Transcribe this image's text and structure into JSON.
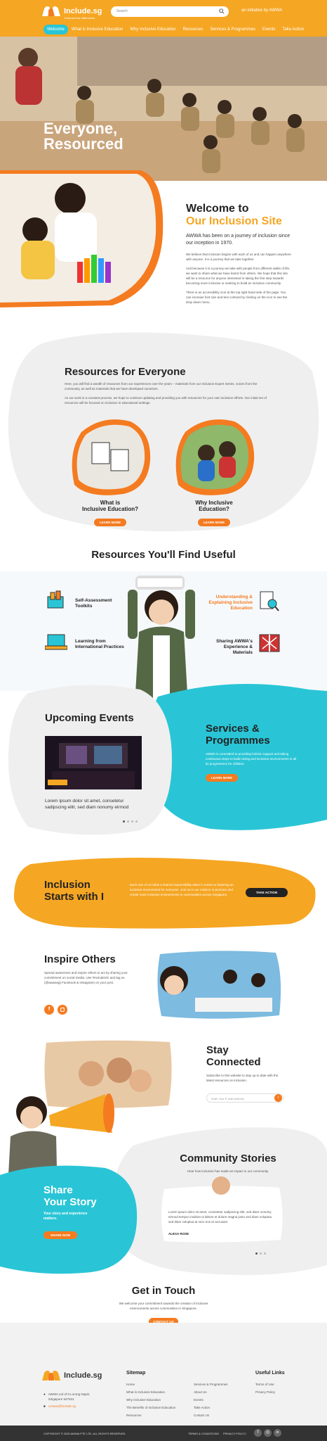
{
  "header": {
    "logo": "Include.sg",
    "logo_sub": "Embrace the differences",
    "search_placeholder": "Search",
    "tagline": "an initiative by AWWA"
  },
  "nav": [
    "Welcome",
    "What is Inclusive Education",
    "Why Inclusive Education",
    "Resources",
    "Services & Programmes",
    "Events",
    "Take Action"
  ],
  "hero": {
    "title_line1": "Everyone,",
    "title_line2": "Resourced"
  },
  "welcome": {
    "title1": "Welcome to",
    "title2": "Our Inclusion Site",
    "lead": "AWWA has been on a journey of inclusion since our inception in 1970.",
    "p1": "We believe that inclusion begins with each of us and can happen anywhere with anyone. It is a journey that we take together.",
    "p2": "And because it is a journey we take with people from different walks of life, we want to share what we have learnt from others. We hope that this site will be a resource for anyone interested in taking the first step towards becoming more inclusive or seeking to build an inclusive community.",
    "p3": "There is an accessibility icon at the top right-hand side of the page. You can increase font size and text contrast by clicking on the icon to see the drop down menu."
  },
  "resources": {
    "title": "Resources for Everyone",
    "p1": "Here, you will find a wealth of resources from our experiences over the years – materials from our Inclusion Expert Series, voices from the community, as well as materials that we have developed ourselves.",
    "p2": "As our work is a constant process, we hope to continue updating and providing you with resources for your own inclusion efforts. Our initial set of resources will be focused on inclusion in educational settings.",
    "card1_l1": "What is",
    "card1_l2": "Inclusive Education?",
    "card2_l1": "Why Inclusive",
    "card2_l2": "Education?",
    "learn_more": "LEARN MORE"
  },
  "useful": {
    "title": "Resources You'll Find Useful",
    "i1": "Self-Assessment Toolkits",
    "i2": "Understanding & Explaining Inclusive Education",
    "i3": "Learning from International Practices",
    "i4": "Sharing AWWA's Experience & Materials"
  },
  "events": {
    "title": "Upcoming Events",
    "text": "Lorem ipsum dolor sit amet, consetetur sadipscing elitr, sed diam nonumy eirmod"
  },
  "services": {
    "title1": "Services &",
    "title2": "Programmes",
    "text": "AWWA is committed to providing holistic support and taking continuous steps to build caring and inclusive environments in all its programmes for children.",
    "btn": "LEARN MORE"
  },
  "inclusion": {
    "title1": "Inclusion",
    "title2": "Starts with I",
    "text": "Each one of us holds a shared responsibility when it comes to fostering an inclusive environment for everyone. Join us in our mission to promote and create more inclusive environments in communities across Singapore.",
    "btn": "TAKE ACTION"
  },
  "inspire": {
    "title": "Inspire Others",
    "text": "Spread awareness and inspire others to act by sharing your commitment on social media. Use #IncludeSG and tag us (@awwasg) Facebook & Instagram) on your post."
  },
  "stay": {
    "title1": "Stay",
    "title2": "Connected",
    "text": "Subscribe to this website to stay up to date with the latest resources on inclusion.",
    "placeholder": "Enter Your E-mail Address"
  },
  "share": {
    "title1": "Share",
    "title2": "Your Story",
    "text": "Your story and experience matters.",
    "btn": "SHARE NOW"
  },
  "community": {
    "title": "Community Stories",
    "sub": "Hear how inclusion has made an impact in our community.",
    "quote": "Lorem ipsum dolor sit amet, consetetur sadipscing elitr, sed diam nonumy eirmod tempor invidunt ut labore et dolore magna justo sed diam voluptua. sed diam voluptua at vero eos et accusam.",
    "name": "ALEXA ROSE"
  },
  "contact": {
    "title": "Get in Touch",
    "text": "We welcome your commitment towards the creation of inclusive environments across communities in Singapore.",
    "btn": "CONTACT US"
  },
  "footer": {
    "logo": "Include.sg",
    "address": "AWWA Ltd of 9 Lorong Napiri, Singapore 547531",
    "email": "contact@include.sg",
    "sitemap_title": "Sitemap",
    "col1": [
      "Home",
      "What is Inclusive Education",
      "Why Inclusive Education",
      "The Benefits of Inclusive Education",
      "Resources"
    ],
    "col2": [
      "Services & Programmes",
      "About Us",
      "Events",
      "Take Action",
      "Contact Us"
    ],
    "useful_title": "Useful Links",
    "useful": [
      "Terms of Use",
      "Privacy Policy"
    ],
    "copyright": "COPYRIGHT © 2020 AWWA PTE LTD. ALL RIGHTS RESERVED",
    "terms": "TERMS & CONDITIONS",
    "privacy": "PRIVACY POLICY"
  },
  "colors": {
    "orange": "#f47b20",
    "yellow": "#f5a623",
    "teal": "#29c5d6",
    "grey": "#efefef"
  }
}
